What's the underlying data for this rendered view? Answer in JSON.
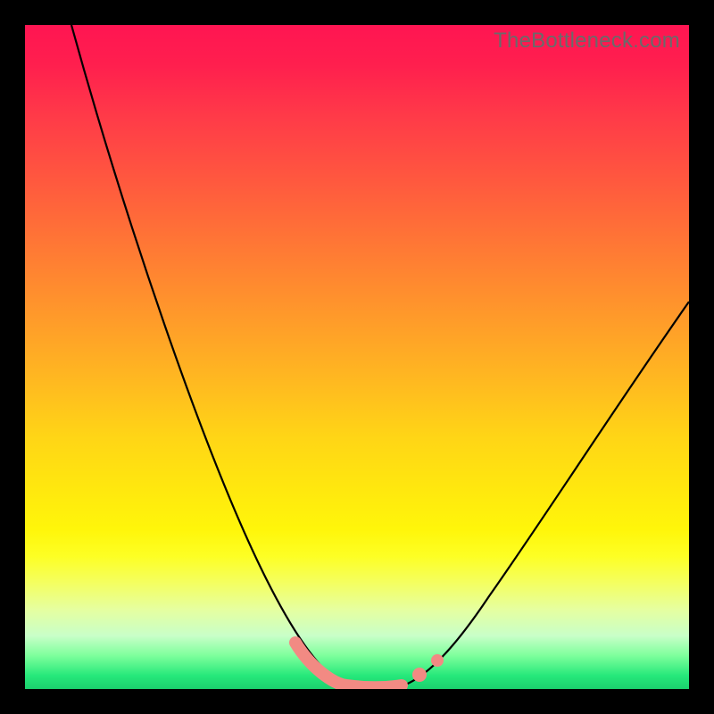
{
  "watermark": "TheBottleneck.com",
  "colors": {
    "frame": "#000000",
    "curve": "#000000",
    "marker": "#f28a83",
    "gradient_top": "#ff1552",
    "gradient_bottom": "#1bd06e"
  },
  "chart_data": {
    "type": "line",
    "title": "",
    "xlabel": "",
    "ylabel": "",
    "xlim": [
      0,
      100
    ],
    "ylim": [
      0,
      100
    ],
    "grid": false,
    "legend": false,
    "series": [
      {
        "name": "left-branch",
        "x": [
          7,
          12,
          18,
          24,
          30,
          34,
          37,
          40,
          43,
          46,
          48
        ],
        "y": [
          100,
          82,
          63,
          45,
          27,
          16,
          9,
          4,
          1.5,
          0.5,
          0
        ]
      },
      {
        "name": "right-branch",
        "x": [
          57,
          59,
          62,
          66,
          71,
          77,
          84,
          92,
          100
        ],
        "y": [
          0,
          1,
          3,
          7,
          13,
          22,
          33,
          46,
          59
        ]
      },
      {
        "name": "valley-floor",
        "x": [
          48,
          50,
          52,
          54,
          56,
          57
        ],
        "y": [
          0,
          0,
          0,
          0,
          0,
          0
        ]
      }
    ],
    "markers": [
      {
        "name": "valley-highlight",
        "x_range": [
          41,
          57
        ],
        "y": 0
      },
      {
        "name": "right-dot-1",
        "x": 59.5,
        "y": 2
      },
      {
        "name": "right-dot-2",
        "x": 62,
        "y": 4
      }
    ],
    "annotations": []
  }
}
